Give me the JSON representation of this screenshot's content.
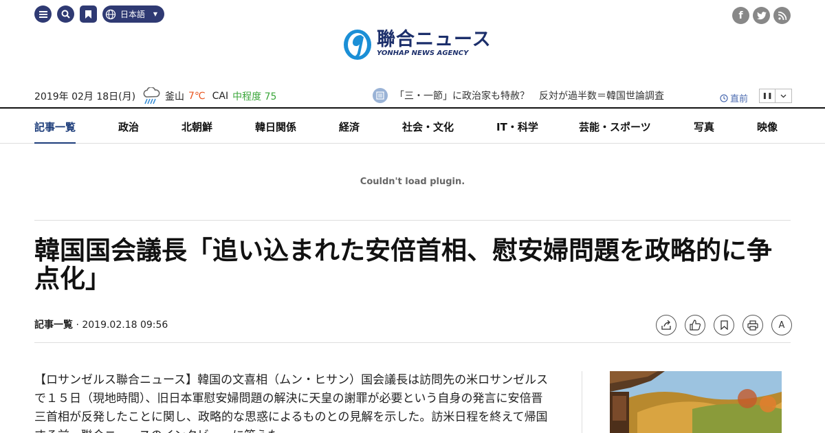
{
  "header": {
    "language": "日本語",
    "icons": [
      "menu-icon",
      "search-icon",
      "bookmark-icon",
      "globe-icon",
      "facebook-icon",
      "twitter-icon",
      "rss-icon"
    ],
    "logo_ja": "聯合ニュース",
    "logo_en": "YONHAP NEWS AGENCY",
    "brand_color": "#1c2f6b"
  },
  "info": {
    "date": "2019年 02月 18日(月)",
    "weather_city": "釜山",
    "weather_temp": "7℃",
    "cai_label": "CAI",
    "cai_value": "中程度 75",
    "ticker": "「三・一節」に政治家も特赦？　反対が過半数＝韓国世論調査",
    "just_now": "直前"
  },
  "nav": {
    "items": [
      "記事一覧",
      "政治",
      "北朝鮮",
      "韓日関係",
      "経済",
      "社会・文化",
      "IT・科学",
      "芸能・スポーツ",
      "写真",
      "映像"
    ],
    "active": "記事一覧"
  },
  "plugin_message": "Couldn't load plugin.",
  "article": {
    "headline": "韓国国会議長「追い込まれた安倍首相、慰安婦問題を政略的に争点化」",
    "category": "記事一覧",
    "timestamp": "· 2019.02.18 09:56",
    "body": "【ロサンゼルス聯合ニュース】韓国の文喜相（ムン・ヒサン）国会議長は訪問先の米ロサンゼルスで１５日（現地時間）、旧日本軍慰安婦問題の解決に天皇の謝罪が必要という自身の発言に安倍晋三首相が反発したことに関し、政略的な思惑によるものとの見解を示した。訪米日程を終えて帰国する前、聯合ニュースのインタビューに答えた。",
    "tools": [
      "share-icon",
      "like-icon",
      "bookmark-icon",
      "print-icon",
      "font-size-icon"
    ],
    "font_tool_label": "A"
  }
}
